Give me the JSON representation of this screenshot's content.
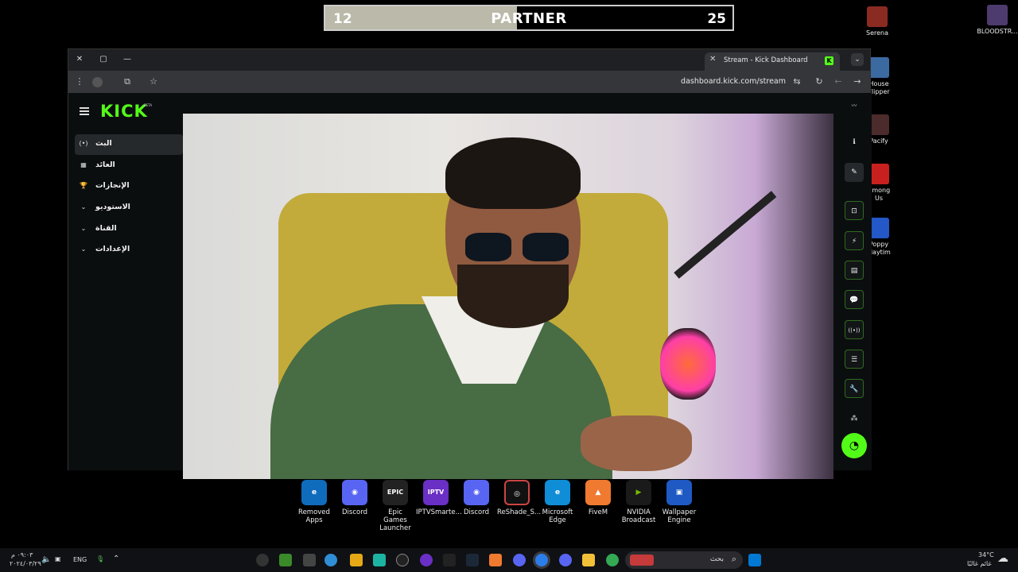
{
  "overlay": {
    "left_value": "12",
    "title": "PARTNER",
    "right_value": "25",
    "progress_fraction": 0.47,
    "fill_color": "#bbb9a9"
  },
  "desktop_icons": [
    {
      "label": "Serena",
      "color": "#8a2b22"
    },
    {
      "label": "BLOODSTR...",
      "color": "#4e3b6e"
    },
    {
      "label": "House Flipper",
      "color": "#3b6aa0"
    },
    {
      "label": "Pacify",
      "color": "#4b2b2b"
    },
    {
      "label": "Among Us",
      "color": "#c8201e"
    },
    {
      "label": "Poppy Playtime",
      "color": "#2457c7"
    }
  ],
  "browser": {
    "tab_title": "Stream - Kick Dashboard",
    "tab_favicon": "K",
    "url": "dashboard.kick.com/stream"
  },
  "kick": {
    "logo": "KICK",
    "beta": "BETA",
    "sidebar": [
      {
        "label": "البث",
        "icon": "(•)"
      },
      {
        "label": "العائد",
        "icon": "▦"
      },
      {
        "label": "الإنجازات",
        "icon": "🏆"
      },
      {
        "label": "الاستوديو",
        "icon": "⌄"
      },
      {
        "label": "القناة",
        "icon": "⌄"
      },
      {
        "label": "الإعدادات",
        "icon": "⌄"
      }
    ]
  },
  "right_tools": [
    {
      "name": "info-icon",
      "glyph": "ℹ"
    },
    {
      "name": "pencil-icon",
      "glyph": "✎"
    },
    {
      "name": "camera-icon",
      "glyph": "⊡"
    },
    {
      "name": "lightning-icon",
      "glyph": "⚡"
    },
    {
      "name": "notes-icon",
      "glyph": "▤"
    },
    {
      "name": "chat-icon",
      "glyph": "💬"
    },
    {
      "name": "broadcast-icon",
      "glyph": "((•))"
    },
    {
      "name": "layout-icon",
      "glyph": "☰"
    },
    {
      "name": "wrench-icon",
      "glyph": "🔧"
    },
    {
      "name": "share-icon",
      "glyph": "⁂"
    }
  ],
  "dock": [
    {
      "label": "Removed Apps",
      "color": "#0f6cbd",
      "glyph": "e"
    },
    {
      "label": "Discord",
      "color": "#5865f2",
      "glyph": "◉"
    },
    {
      "label": "Epic Games Launcher",
      "color": "#222222",
      "glyph": "EPIC"
    },
    {
      "label": "IPTVSmarte...",
      "color": "#6a2fc4",
      "glyph": "IPTV"
    },
    {
      "label": "Discord",
      "color": "#5865f2",
      "glyph": "◉"
    },
    {
      "label": "ReShade_S...",
      "color": "#111111",
      "glyph": "◎"
    },
    {
      "label": "Microsoft Edge",
      "color": "#0f8dd6",
      "glyph": "e"
    },
    {
      "label": "FiveM",
      "color": "#f07a30",
      "glyph": "▲"
    },
    {
      "label": "NVIDIA Broadcast",
      "color": "#1a1a1a",
      "glyph": "▶"
    },
    {
      "label": "Wallpaper Engine",
      "color": "#1f59c4",
      "glyph": "▣"
    }
  ],
  "taskbar": {
    "time": "٠٩:٠٣ م",
    "date": "٢٠٢٤/٠٣/٢٩",
    "lang": "ENG",
    "search_placeholder": "بحث",
    "weather_temp": "34°C",
    "weather_desc": "غائم غالبًا"
  }
}
